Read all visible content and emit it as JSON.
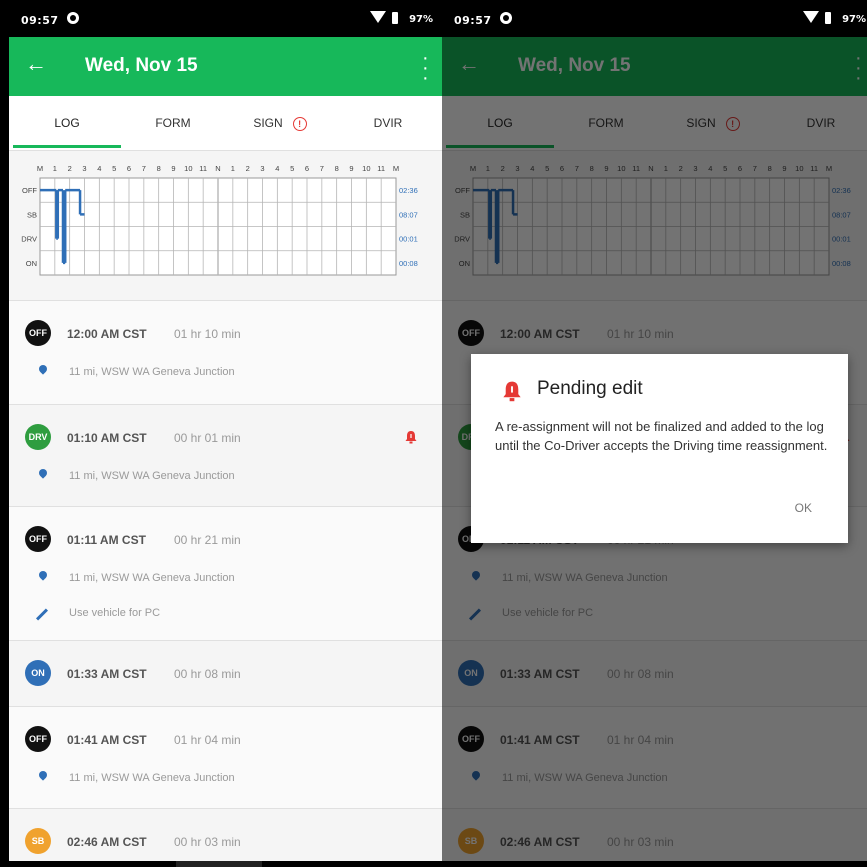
{
  "status_bar": {
    "time": "09:57",
    "battery": "97%"
  },
  "app_bar": {
    "title": "Wed, Nov 15"
  },
  "tabs": [
    {
      "label": "LOG",
      "active": true
    },
    {
      "label": "FORM",
      "active": false
    },
    {
      "label": "SIGN",
      "alert": true
    },
    {
      "label": "DVIR",
      "active": false
    }
  ],
  "graph": {
    "hours": [
      "M",
      "1",
      "2",
      "3",
      "4",
      "5",
      "6",
      "7",
      "8",
      "9",
      "10",
      "11",
      "N",
      "1",
      "2",
      "3",
      "4",
      "5",
      "6",
      "7",
      "8",
      "9",
      "10",
      "11",
      "M"
    ],
    "rows": [
      "OFF",
      "SB",
      "DRV",
      "ON"
    ],
    "totals": [
      "02:36",
      "08:07",
      "00:01",
      "00:08"
    ],
    "segments": [
      {
        "status": "OFF",
        "start_hour": 0.0,
        "end_hour": 1.1
      },
      {
        "status": "DRV",
        "start_hour": 1.1,
        "end_hour": 1.2
      },
      {
        "status": "OFF",
        "start_hour": 1.2,
        "end_hour": 1.55
      },
      {
        "status": "ON",
        "start_hour": 1.55,
        "end_hour": 1.7
      },
      {
        "status": "OFF",
        "start_hour": 1.7,
        "end_hour": 2.7
      },
      {
        "status": "SB",
        "start_hour": 2.7,
        "end_hour": 3.0
      }
    ],
    "colors": {
      "line": "#2f6fb7",
      "grid": "#b5b5b5",
      "accent": "#17b85a"
    }
  },
  "entries": [
    {
      "badge": "OFF",
      "badge_color": "#111111",
      "time": "12:00 AM CST",
      "duration": "01 hr 10 min",
      "location": "11 mi, WSW WA Geneva Junction",
      "note": "",
      "warning": false
    },
    {
      "badge": "DRV",
      "badge_color": "#2e9d3f",
      "time": "01:10 AM CST",
      "duration": "00 hr 01 min",
      "location": "11 mi, WSW WA Geneva Junction",
      "note": "",
      "warning": true
    },
    {
      "badge": "OFF",
      "badge_color": "#111111",
      "time": "01:11 AM CST",
      "duration": "00 hr 21 min",
      "location": "11 mi, WSW WA Geneva Junction",
      "note": "Use vehicle for PC",
      "warning": false
    },
    {
      "badge": "ON",
      "badge_color": "#2f6fb7",
      "time": "01:33 AM CST",
      "duration": "00 hr 08 min",
      "location": "",
      "note": "",
      "warning": false
    },
    {
      "badge": "OFF",
      "badge_color": "#111111",
      "time": "01:41 AM CST",
      "duration": "01 hr 04 min",
      "location": "11 mi, WSW WA Geneva Junction",
      "note": "",
      "warning": false
    },
    {
      "badge": "SB",
      "badge_color": "#f0a22e",
      "time": "02:46 AM CST",
      "duration": "00 hr 03 min",
      "location": "",
      "note": "",
      "warning": false
    }
  ],
  "dialog": {
    "title": "Pending edit",
    "message": "A re-assignment will not be finalized and added to the log until the Co-Driver accepts the Driving time reassignment.",
    "ok_label": "OK"
  },
  "icons": {
    "back": "arrow-left-icon",
    "more": "more-vert-icon",
    "location": "map-pin-icon",
    "note": "pencil-icon",
    "warning": "alarm-bell-icon",
    "alert": "alert-circle-icon"
  }
}
